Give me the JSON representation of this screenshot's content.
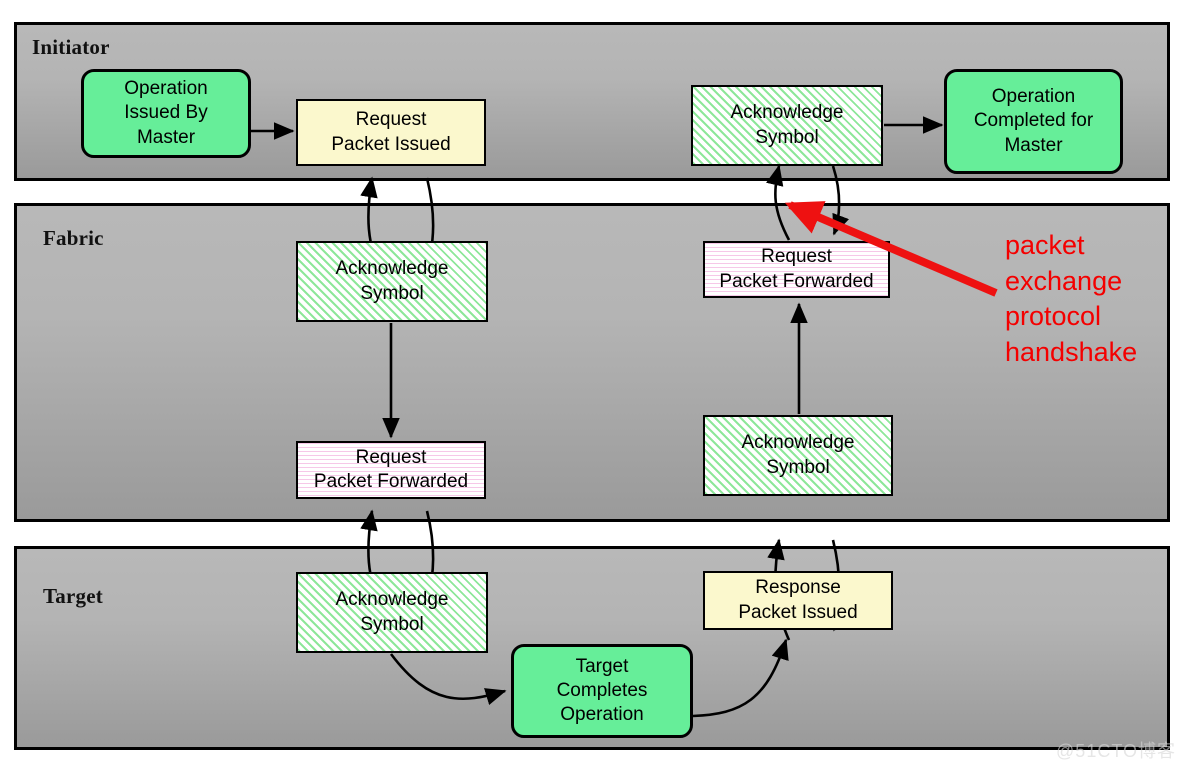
{
  "diagram": {
    "title": "packet exchange protocol handshake",
    "colors": {
      "green_fill": "#66ee99",
      "yellow_fill": "#fbf8cd",
      "hatch_green": "#8ee79a",
      "hatch_pink": "#f6c8e8",
      "band_gradient_top": "#b8b8b8",
      "band_gradient_bottom": "#9a9a9a",
      "annotation_red": "#f40000",
      "border": "#000000"
    }
  },
  "bands": [
    {
      "label": "Initiator"
    },
    {
      "label": "Fabric"
    },
    {
      "label": "Target"
    }
  ],
  "nodes": {
    "operation_issued_by_master": "Operation\nIssued By\nMaster",
    "request_packet_issued": "Request\nPacket Issued",
    "acknowledge_symbol_initiator": "Acknowledge\nSymbol",
    "operation_completed_for_master": "Operation\nCompleted for\nMaster",
    "acknowledge_symbol_fabric_left": "Acknowledge\nSymbol",
    "request_packet_forwarded_fabric_right": "Request\nPacket Forwarded",
    "request_packet_forwarded_fabric_left": "Request\nPacket Forwarded",
    "acknowledge_symbol_fabric_right": "Acknowledge\nSymbol",
    "acknowledge_symbol_target": "Acknowledge\nSymbol",
    "response_packet_issued": "Response\nPacket Issued",
    "target_completes_operation": "Target\nCompletes\nOperation"
  },
  "annotation": {
    "text": "packet\nexchange\nprotocol\nhandshake"
  },
  "watermark": {
    "text": "@51CTO博客"
  }
}
